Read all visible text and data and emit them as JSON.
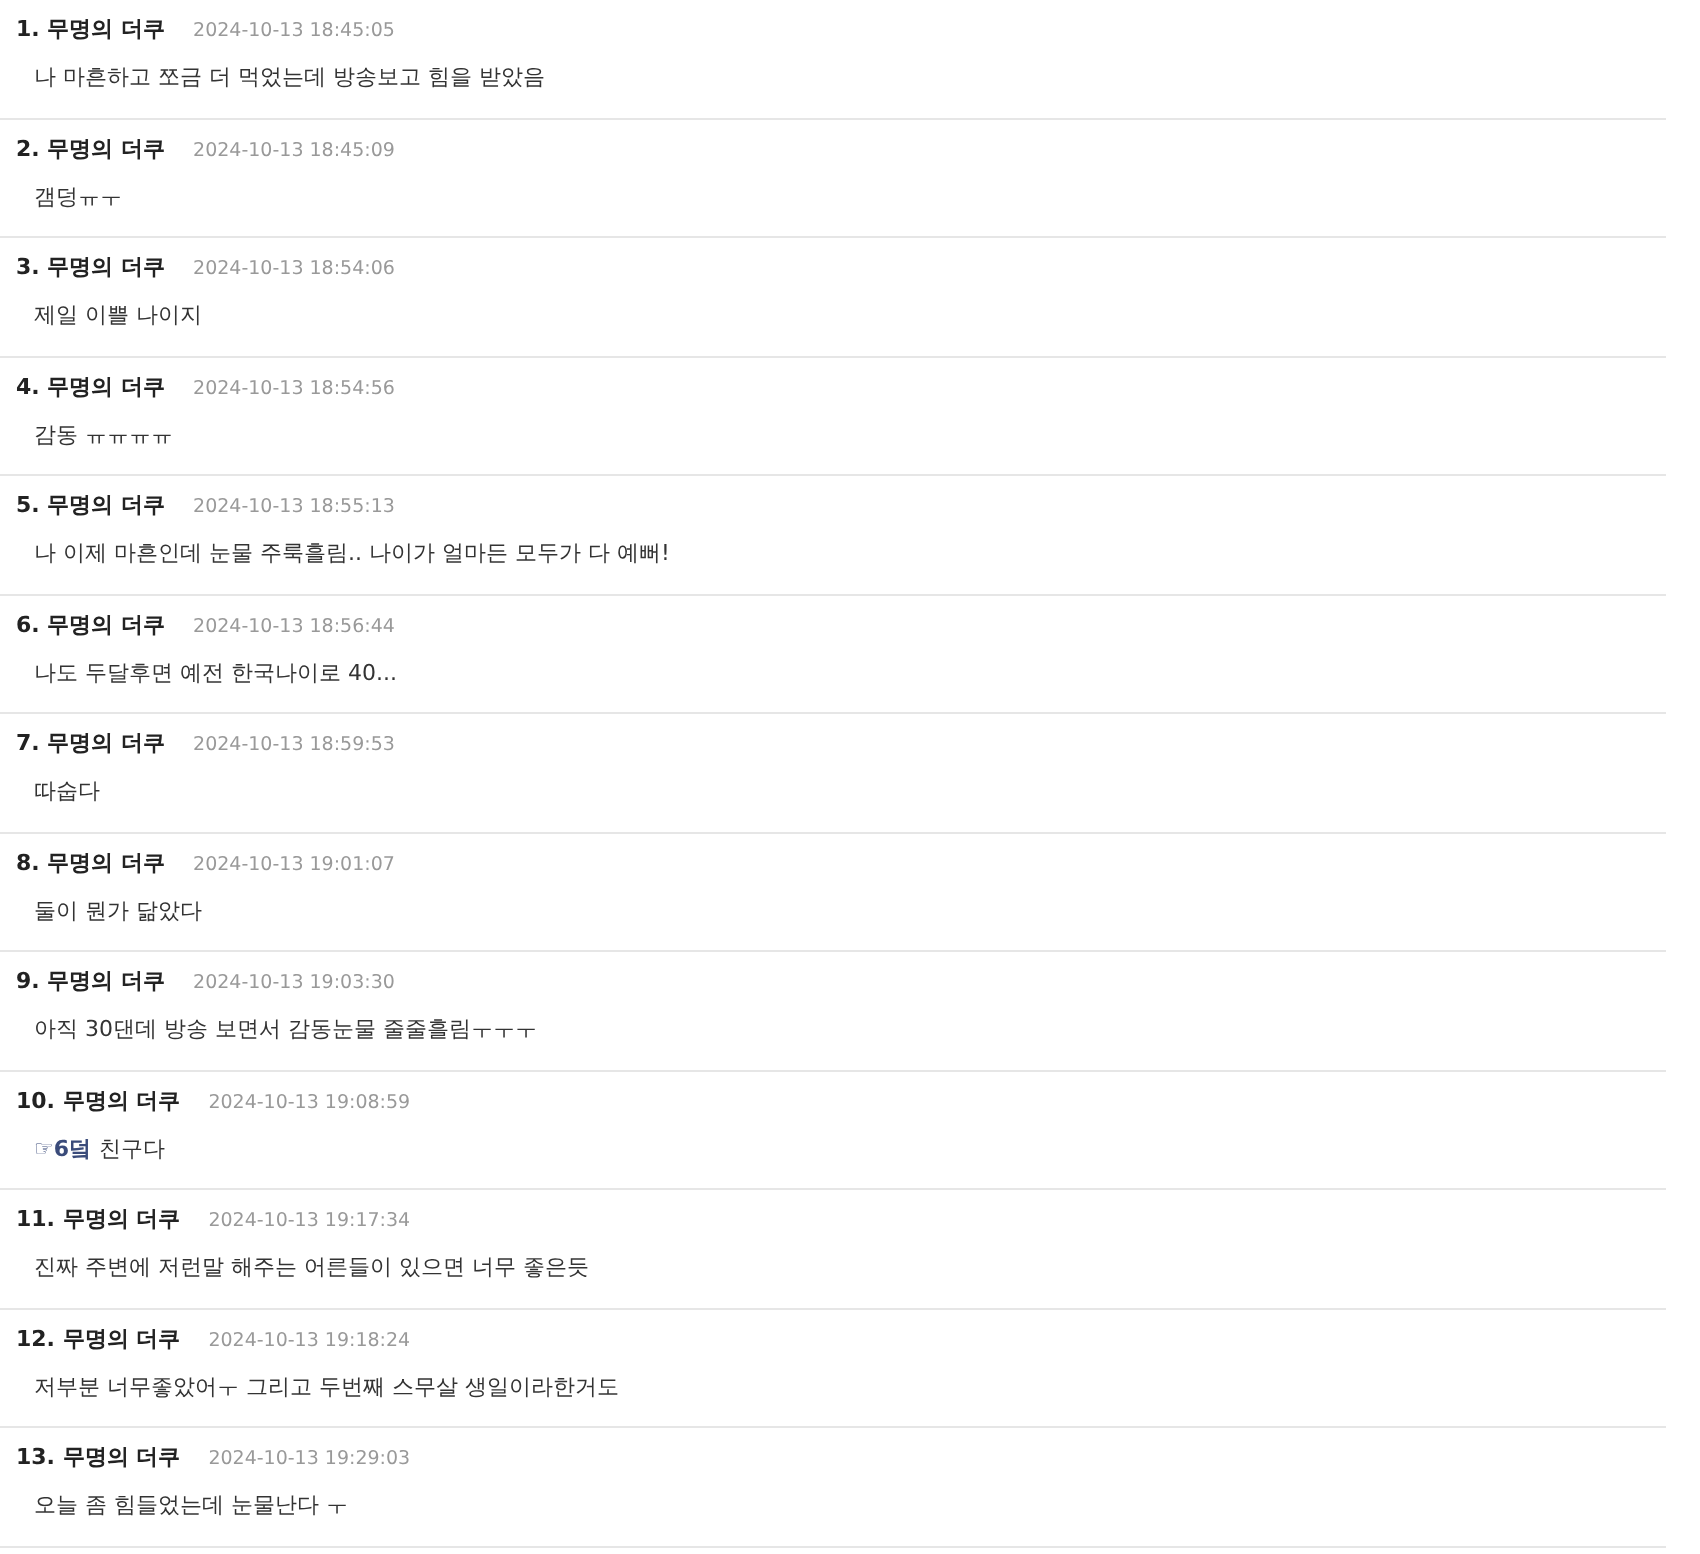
{
  "comments": [
    {
      "number": "1.",
      "author": "무명의 더쿠",
      "time": "2024-10-13 18:45:05",
      "text": "나 마흔하고 쪼금 더 먹었는데 방송보고 힘을 받았음"
    },
    {
      "number": "2.",
      "author": "무명의 더쿠",
      "time": "2024-10-13 18:45:09",
      "text": "갬덩ㅠㅜ"
    },
    {
      "number": "3.",
      "author": "무명의 더쿠",
      "time": "2024-10-13 18:54:06",
      "text": "제일 이쁠 나이지"
    },
    {
      "number": "4.",
      "author": "무명의 더쿠",
      "time": "2024-10-13 18:54:56",
      "text": "감동 ㅠㅠㅠㅠ"
    },
    {
      "number": "5.",
      "author": "무명의 더쿠",
      "time": "2024-10-13 18:55:13",
      "text": "나 이제 마흔인데 눈물 주룩흘림.. 나이가 얼마든 모두가 다 예뻐!"
    },
    {
      "number": "6.",
      "author": "무명의 더쿠",
      "time": "2024-10-13 18:56:44",
      "text": "나도 두달후면 예전 한국나이로 40..."
    },
    {
      "number": "7.",
      "author": "무명의 더쿠",
      "time": "2024-10-13 18:59:53",
      "text": "따숩다"
    },
    {
      "number": "8.",
      "author": "무명의 더쿠",
      "time": "2024-10-13 19:01:07",
      "text": "둘이 뭔가 닮았다"
    },
    {
      "number": "9.",
      "author": "무명의 더쿠",
      "time": "2024-10-13 19:03:30",
      "text": "아직 30댄데 방송 보면서 감동눈물 줄줄흘림ㅜㅜㅜ"
    },
    {
      "number": "10.",
      "author": "무명의 더쿠",
      "time": "2024-10-13 19:08:59",
      "reply_to": "☞6덬",
      "text": "친구다"
    },
    {
      "number": "11.",
      "author": "무명의 더쿠",
      "time": "2024-10-13 19:17:34",
      "text": "진짜 주변에 저런말 해주는 어른들이 있으면 너무 좋은듯"
    },
    {
      "number": "12.",
      "author": "무명의 더쿠",
      "time": "2024-10-13 19:18:24",
      "text": "저부분 너무좋았어ㅜ 그리고 두번째 스무살 생일이라한거도"
    },
    {
      "number": "13.",
      "author": "무명의 더쿠",
      "time": "2024-10-13 19:29:03",
      "text": "오늘 좀 힘들었는데 눈물난다 ㅜ"
    }
  ]
}
